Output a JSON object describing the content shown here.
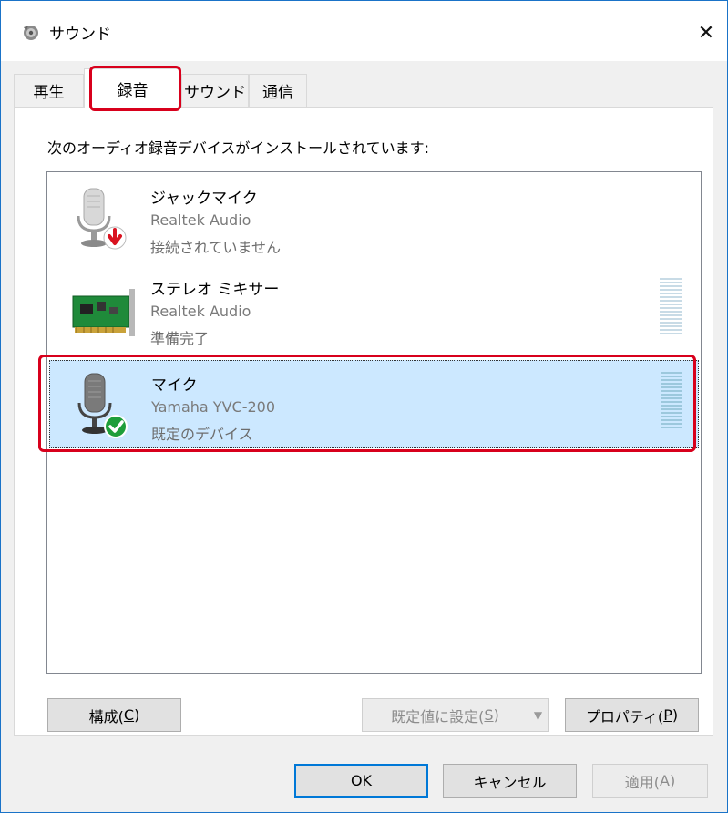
{
  "window": {
    "title": "サウンド",
    "close_glyph": "✕"
  },
  "tabs": [
    {
      "label": "再生",
      "active": false
    },
    {
      "label": "録音",
      "active": true
    },
    {
      "label": "サウンド",
      "active": false
    },
    {
      "label": "通信",
      "active": false
    }
  ],
  "recording": {
    "instruction": "次のオーディオ録音デバイスがインストールされています:",
    "devices": [
      {
        "name": "ジャックマイク",
        "driver": "Realtek Audio",
        "status": "接続されていません",
        "icon": "microphone-disconnected-icon",
        "selected": false
      },
      {
        "name": "ステレオ ミキサー",
        "driver": "Realtek Audio",
        "status": "準備完了",
        "icon": "sound-card-icon",
        "selected": false
      },
      {
        "name": "マイク",
        "driver": "Yamaha YVC-200",
        "status": "既定のデバイス",
        "icon": "microphone-default-icon",
        "selected": true
      }
    ]
  },
  "buttons": {
    "configure": {
      "label": "構成(",
      "key": "C",
      "suffix": ")"
    },
    "set_default": {
      "label": "既定値に設定(",
      "key": "S",
      "suffix": ")"
    },
    "properties": {
      "label": "プロパティ(",
      "key": "P",
      "suffix": ")"
    },
    "ok": "OK",
    "cancel": "キャンセル",
    "apply": {
      "label": "適用(",
      "key": "A",
      "suffix": ")"
    }
  },
  "colors": {
    "highlight_red": "#d8001c",
    "selection_blue": "#cce8ff",
    "window_border": "#1a73c8",
    "default_check_green": "#1e9e3a",
    "disconnected_red": "#d9121f"
  }
}
